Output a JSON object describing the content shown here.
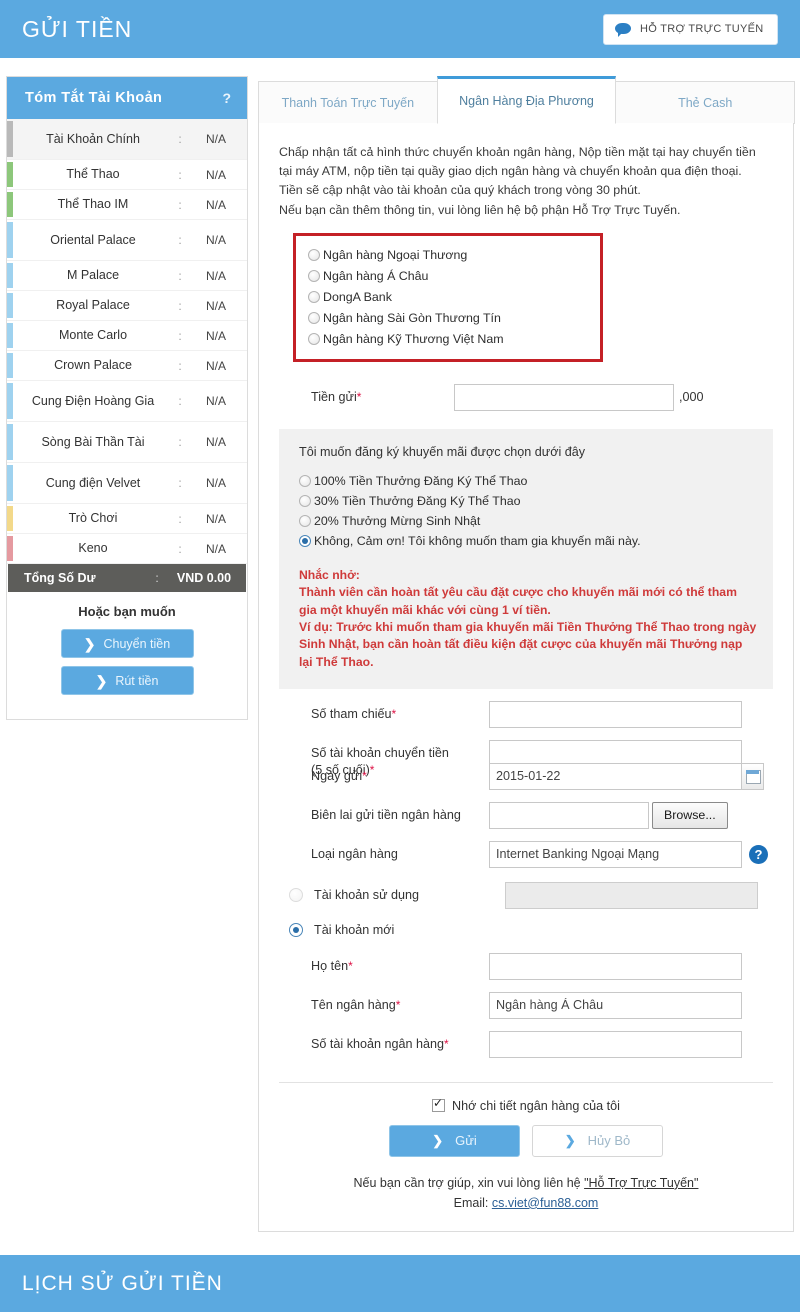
{
  "header": {
    "title": "GỬI TIỀN",
    "support_button": "HỖ TRỢ TRỰC TUYẾN",
    "support_icon": "speech-bubble-icon"
  },
  "sidebar": {
    "title": "Tóm Tắt Tài Khoản",
    "help": "?",
    "accounts": [
      {
        "name": "Tài Khoản Chính",
        "value": "N/A",
        "color": "#b9b9b9"
      },
      {
        "name": "Thể Thao",
        "value": "N/A",
        "color": "#8dc77b"
      },
      {
        "name": "Thể Thao IM",
        "value": "N/A",
        "color": "#8dc77b"
      },
      {
        "name": "Oriental Palace",
        "value": "N/A",
        "color": "#9fd2ef"
      },
      {
        "name": "M Palace",
        "value": "N/A",
        "color": "#9fd2ef"
      },
      {
        "name": "Royal Palace",
        "value": "N/A",
        "color": "#9fd2ef"
      },
      {
        "name": "Monte Carlo",
        "value": "N/A",
        "color": "#9fd2ef"
      },
      {
        "name": "Crown Palace",
        "value": "N/A",
        "color": "#9fd2ef"
      },
      {
        "name": "Cung Điện Hoàng Gia",
        "value": "N/A",
        "color": "#9fd2ef"
      },
      {
        "name": "Sòng Bài Thần Tài",
        "value": "N/A",
        "color": "#9fd2ef"
      },
      {
        "name": "Cung điện Velvet",
        "value": "N/A",
        "color": "#9fd2ef"
      },
      {
        "name": "Trò Chơi",
        "value": "N/A",
        "color": "#f3d98a"
      },
      {
        "name": "Keno",
        "value": "N/A",
        "color": "#e59aa0"
      }
    ],
    "total_label": "Tổng Số Dư",
    "total_value": "VND 0.00",
    "or_label": "Hoặc bạn muốn",
    "transfer_button": "Chuyển tiền",
    "withdraw_button": "Rút tiền"
  },
  "tabs": [
    {
      "label": "Thanh Toán Trực Tuyến",
      "active": false
    },
    {
      "label": "Ngân Hàng Địa Phương",
      "active": true
    },
    {
      "label": "Thẻ Cash",
      "active": false
    }
  ],
  "intro": [
    "Chấp nhận tất cả hình thức chuyển khoản ngân hàng, Nộp tiền mặt tại hay chuyển tiền",
    "tại máy ATM, nộp tiền tại quầy giao dịch ngân hàng và chuyển khoản qua điện thoại.",
    "Tiền sẽ cập nhật vào tài khoản của quý khách trong vòng 30 phút.",
    "Nếu bạn cần thêm thông tin, vui lòng liên hệ bộ phận Hỗ Trợ Trực Tuyến."
  ],
  "banks": {
    "highlight_color": "#c42026",
    "options": [
      {
        "label": "Ngân hàng Ngoại Thương",
        "selected": false
      },
      {
        "label": "Ngân hàng Á Châu",
        "selected": false
      },
      {
        "label": "DongA Bank",
        "selected": false
      },
      {
        "label": "Ngân hàng Sài Gòn Thương Tín",
        "selected": false
      },
      {
        "label": "Ngân hàng Kỹ Thương Việt Nam",
        "selected": false
      }
    ]
  },
  "amount": {
    "label": "Tiền gửi",
    "required": "*",
    "value": "",
    "suffix": ",000"
  },
  "promo": {
    "question": "Tôi muốn đăng ký khuyến mãi được chọn dưới đây",
    "options": [
      {
        "label": "100% Tiền Thưởng Đăng Ký Thể Thao",
        "selected": false
      },
      {
        "label": "30% Tiền Thưởng Đăng Ký Thể Thao",
        "selected": false
      },
      {
        "label": "20% Thưởng Mừng Sinh Nhật",
        "selected": false
      },
      {
        "label": "Không, Cảm ơn! Tôi không muốn tham gia khuyến mãi này.",
        "selected": true
      }
    ],
    "warning_color": "#cf3a3a",
    "warning": [
      "Nhắc nhở:",
      "Thành viên cần hoàn tất yêu cầu đặt cược cho khuyến mãi mới có thể tham",
      "gia một khuyến mãi khác với cùng 1 ví tiền.",
      "Ví dụ: Trước khi muốn tham gia khuyến mãi Tiền Thưởng Thể Thao trong ngày",
      "Sinh Nhật, bạn cần hoàn tất điều kiện đặt cược của khuyến mãi Thưởng nạp",
      "lại Thể Thao."
    ]
  },
  "form": {
    "reference": {
      "label": "Số tham chiếu",
      "required": "*",
      "value": ""
    },
    "account_from": {
      "label_line1": "Số tài khoản chuyển tiền",
      "label_line2": "(5 số cuối)",
      "required": "*",
      "value": ""
    },
    "deposit_date": {
      "label": "Ngày gửi",
      "required": "*",
      "value": "2015-01-22",
      "icon": "calendar-icon"
    },
    "receipt": {
      "label": "Biên lai gửi tiền ngân hàng",
      "value": "",
      "browse_button": "Browse..."
    },
    "bank_type": {
      "label": "Loại ngân hàng",
      "value": "Internet Banking Ngoại Mạng",
      "help_icon": "question-mark-icon"
    },
    "existing_account": {
      "label": "Tài khoản sử dụng",
      "selected": false,
      "value": ""
    },
    "new_account": {
      "label": "Tài khoản mới",
      "selected": true
    },
    "full_name": {
      "label": "Họ tên",
      "required": "*",
      "value": ""
    },
    "bank_name": {
      "label": "Tên ngân hàng",
      "required": "*",
      "value": "Ngân hàng Á Châu"
    },
    "bank_account_no": {
      "label": "Số tài khoản ngân hàng",
      "required": "*",
      "value": ""
    }
  },
  "footer": {
    "remember_label": "Nhớ chi tiết ngân hàng của tôi",
    "remember_checked": true,
    "submit_button": "Gửi",
    "cancel_button": "Hủy Bỏ",
    "help_text_prefix": "Nếu bạn cần trợ giúp, xin vui lòng liên hệ ",
    "help_link": "\"Hỗ Trợ Trực Tuyến\"",
    "email_prefix": "Email: ",
    "email": "cs.viet@fun88.com"
  },
  "bottom_banner": {
    "title": "LỊCH SỬ GỬI TIỀN"
  },
  "colors": {
    "brand": "#5ba9e0",
    "active_tab_border": "#3f9bd9",
    "total_bar": "#5d5d5a"
  }
}
